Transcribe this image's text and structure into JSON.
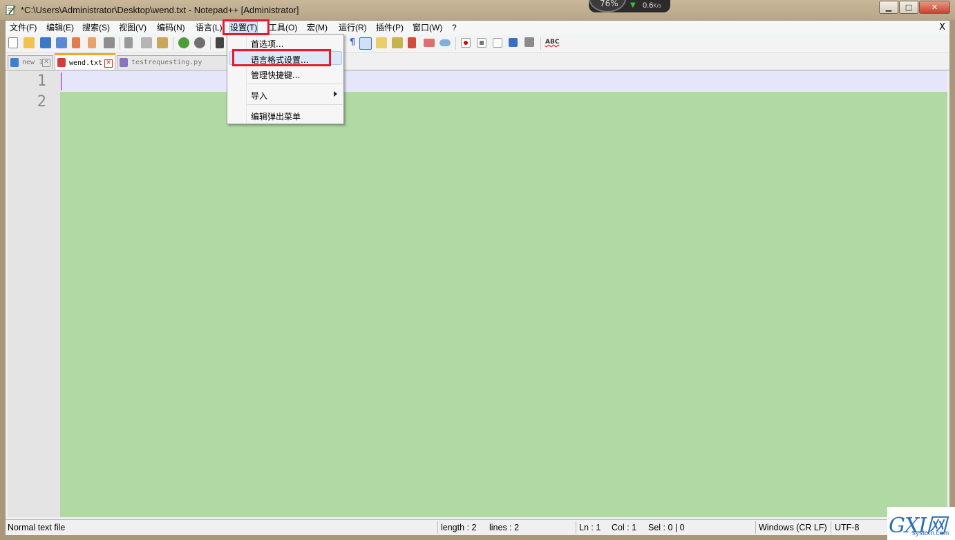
{
  "window": {
    "title": "*C:\\Users\\Administrator\\Desktop\\wend.txt - Notepad++ [Administrator]",
    "minimize_label": "▁",
    "maximize_label": "□",
    "close_label": "✕"
  },
  "net_widget": {
    "percent": "76%",
    "speed": "0.6",
    "unit": "K/s"
  },
  "menubar": {
    "items": [
      "文件(F)",
      "编辑(E)",
      "搜索(S)",
      "视图(V)",
      "编码(N)",
      "语言(L)",
      "设置(T)",
      "工具(O)",
      "宏(M)",
      "运行(R)",
      "插件(P)",
      "窗口(W)",
      "?"
    ],
    "active_index": 6,
    "close_doc": "X"
  },
  "dropdown": {
    "items": [
      "首选项...",
      "语言格式设置...",
      "管理快捷键...",
      "导入",
      "编辑弹出菜单"
    ],
    "highlighted_index": 1
  },
  "tabs": [
    {
      "label": "new 1",
      "icon_color": "#3f7fcf",
      "active": false
    },
    {
      "label": "wend.txt",
      "icon_color": "#d83a3a",
      "active": true
    },
    {
      "label": "testrequesting.py",
      "icon_color": "#8a73c0",
      "active": false
    }
  ],
  "editor": {
    "line_numbers": [
      "1",
      "2"
    ]
  },
  "statusbar": {
    "file_type": "Normal text file",
    "length": "length : 2",
    "lines": "lines : 2",
    "ln": "Ln : 1",
    "col": "Col : 1",
    "sel": "Sel : 0 | 0",
    "eol": "Windows (CR LF)",
    "encoding": "UTF-8"
  },
  "watermark": {
    "logo": "GXI网",
    "site": "system.com"
  },
  "colors": {
    "editor_bg": "#b0d9a4",
    "current_line": "#e6e6fa",
    "highlight_box": "#e8192c",
    "active_tab_accent": "#f5a623"
  }
}
